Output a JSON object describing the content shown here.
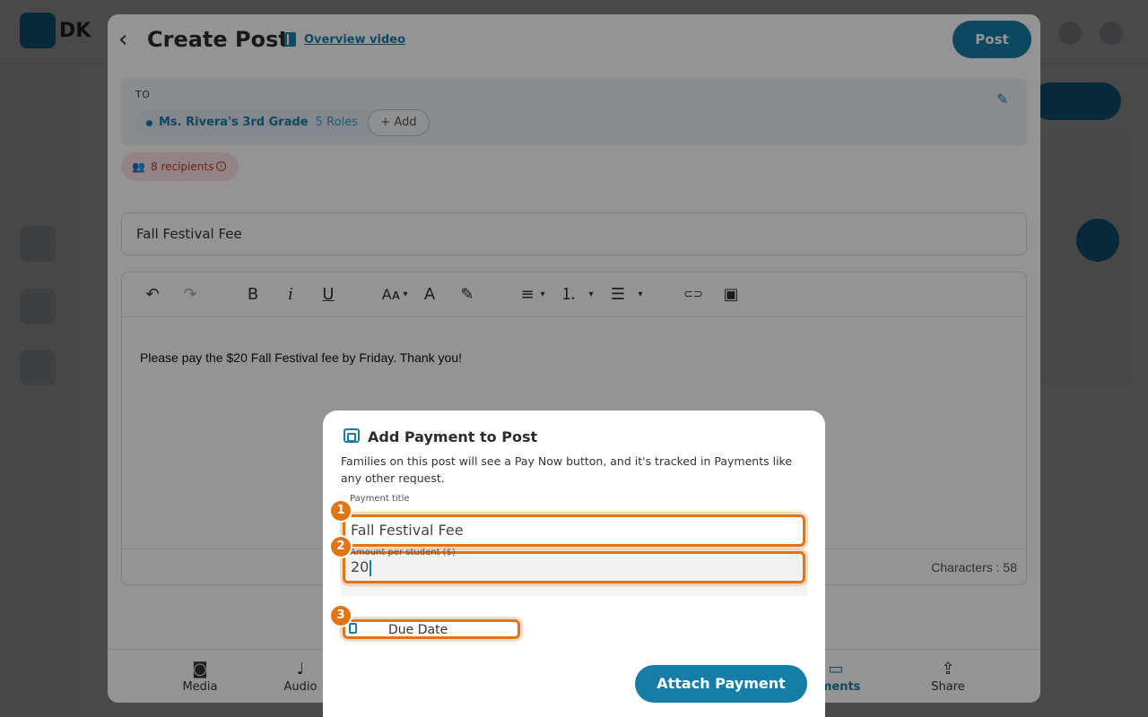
{
  "background": {
    "logo_text": "DK"
  },
  "post": {
    "title": "Create Post",
    "overview_link": "Overview video",
    "post_button": "Post",
    "to_label": "TO",
    "chip_name": "Ms. Rivera's 3rd Grade",
    "chip_roles": "5 Roles",
    "chip_remove": "×",
    "add_label": "+ Add",
    "recipients": "8 recipients",
    "title_value": "Fall Festival Fee",
    "body_text": "Please pay the $20 Fall Festival fee by Friday. Thank you!",
    "char_count": "Characters : 58"
  },
  "toolbar": {
    "undo": "↶",
    "redo": "↷",
    "bold": "B",
    "italic": "i",
    "underline": "U",
    "font_size": "Aᴀ",
    "text_color": "A",
    "highlight": "✎",
    "align": "≡",
    "ordered_list": "⒈",
    "bullet_list": "☰",
    "link": "⊂⊃",
    "image": "▣",
    "dropdown": "▾"
  },
  "bottom_bar": [
    {
      "label": "Media",
      "icon": "camera-icon"
    },
    {
      "label": "Audio",
      "icon": "mic-icon"
    },
    {
      "label": "nments",
      "icon": "comment-icon"
    },
    {
      "label": "Share",
      "icon": "share-icon"
    }
  ],
  "payment": {
    "title": "Add Payment to Post",
    "description": "Families on this post will see a Pay Now button, and it's tracked in Payments like any other request.",
    "title_label": "Payment title",
    "title_value": "Fall Festival Fee",
    "amount_label": "Amount per student ($)",
    "amount_value": "20",
    "due_date_label": "Due Date",
    "attach_button": "Attach Payment",
    "badges": [
      "1",
      "2",
      "3"
    ]
  },
  "colors": {
    "accent": "#167ea6",
    "highlight": "#e07518",
    "recipient": "#c0392b"
  }
}
